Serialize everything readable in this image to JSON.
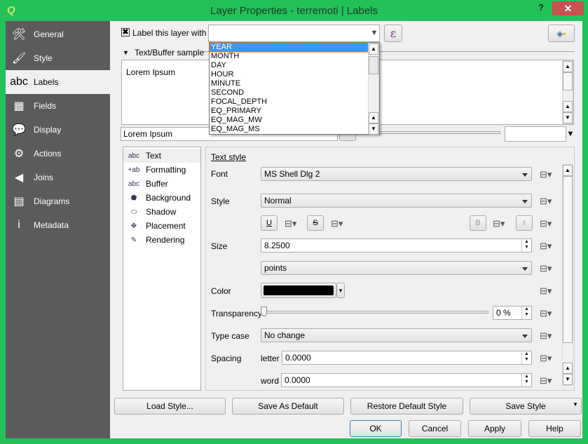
{
  "window": {
    "title": "Layer Properties - terremoti | Labels",
    "help": "?",
    "close": "✕",
    "accent": "#22c15a"
  },
  "sidebar": {
    "items": [
      {
        "label": "General",
        "icon": "🛠"
      },
      {
        "label": "Style",
        "icon": "🖌"
      },
      {
        "label": "Labels",
        "icon": "abc"
      },
      {
        "label": "Fields",
        "icon": "▦"
      },
      {
        "label": "Display",
        "icon": "💬"
      },
      {
        "label": "Actions",
        "icon": "⚙"
      },
      {
        "label": "Joins",
        "icon": "◀"
      },
      {
        "label": "Diagrams",
        "icon": "▤"
      },
      {
        "label": "Metadata",
        "icon": "i"
      }
    ],
    "selected": "Labels"
  },
  "top": {
    "checkbox_label": "Label this layer with",
    "checked": true,
    "field_value": "",
    "expression_button": "ε",
    "dropdown_options": [
      "YEAR",
      "MONTH",
      "DAY",
      "HOUR",
      "MINUTE",
      "SECOND",
      "FOCAL_DEPTH",
      "EQ_PRIMARY",
      "EQ_MAG_MW",
      "EQ_MAG_MS"
    ],
    "highlighted": "YEAR"
  },
  "sample": {
    "header": "Text/Buffer sample",
    "preview_text": "Lorem Ipsum",
    "input_value": "Lorem Ipsum"
  },
  "subtabs": [
    {
      "label": "Text",
      "icon": "abc"
    },
    {
      "label": "Formatting",
      "icon": "+ab"
    },
    {
      "label": "Buffer",
      "icon": "abc"
    },
    {
      "label": "Background",
      "icon": "⬟"
    },
    {
      "label": "Shadow",
      "icon": "⬭"
    },
    {
      "label": "Placement",
      "icon": "✥"
    },
    {
      "label": "Rendering",
      "icon": "✎"
    }
  ],
  "text_style": {
    "heading": "Text style",
    "font_label": "Font",
    "font": "MS Shell Dlg 2",
    "style_label": "Style",
    "style": "Normal",
    "underline": "U",
    "strike": "S",
    "bold": "B",
    "italic": "I",
    "size_label": "Size",
    "size": "8.2500",
    "unit": "points",
    "color_label": "Color",
    "color": "#000000",
    "transparency_label": "Transparency",
    "transparency": "0 %",
    "transparency_value": 0,
    "typecase_label": "Type case",
    "typecase": "No change",
    "spacing_label": "Spacing",
    "letter_label": "letter",
    "letter": "0.0000",
    "word_label": "word",
    "word": "0.0000"
  },
  "buttons": {
    "load": "Load Style...",
    "save_default": "Save As Default",
    "restore": "Restore Default Style",
    "save_style": "Save Style",
    "ok": "OK",
    "cancel": "Cancel",
    "apply": "Apply",
    "help": "Help"
  }
}
